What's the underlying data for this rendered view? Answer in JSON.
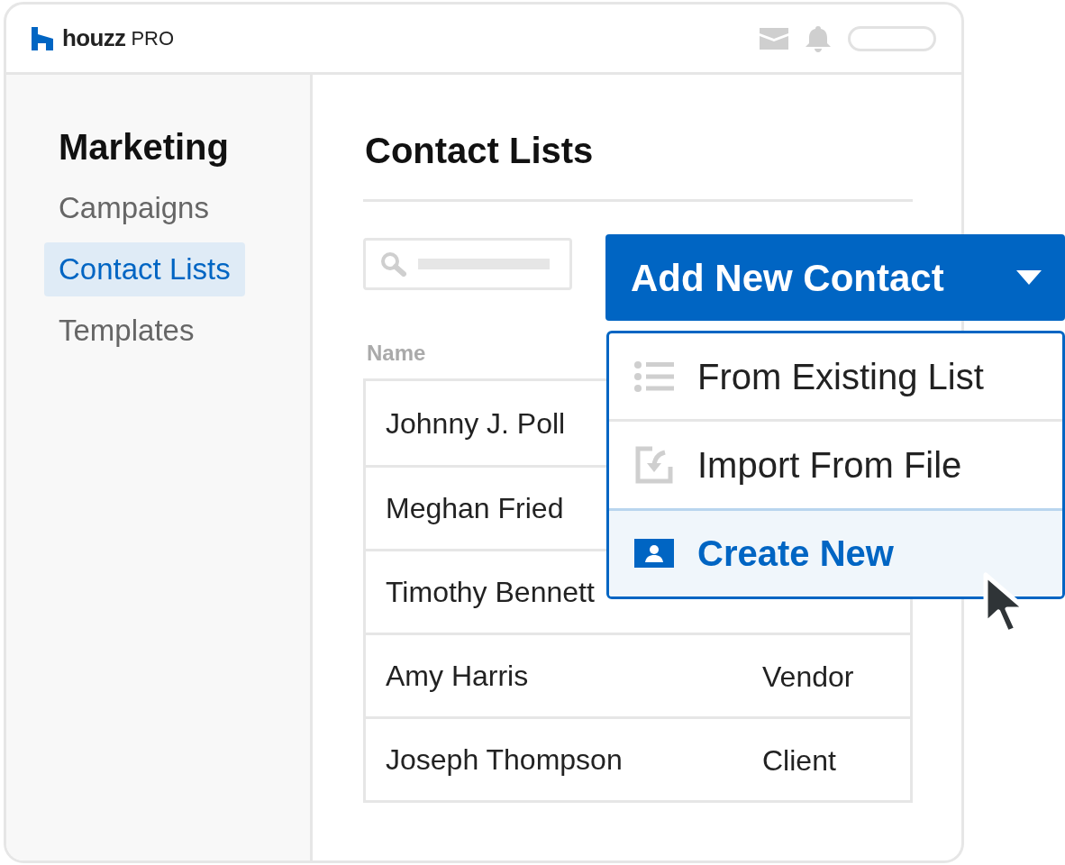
{
  "header": {
    "logo": "houzz",
    "logo_suffix": "PRO"
  },
  "sidebar": {
    "title": "Marketing",
    "items": [
      {
        "label": "Campaigns",
        "selected": false
      },
      {
        "label": "Contact Lists",
        "selected": true
      },
      {
        "label": "Templates",
        "selected": false
      }
    ]
  },
  "page_title": "Contact Lists",
  "add_button": {
    "label": "Add New Contact"
  },
  "dropdown": {
    "items": [
      {
        "kind": "list",
        "label": "From Existing List",
        "selected": false
      },
      {
        "kind": "import",
        "label": "Import From File",
        "selected": false
      },
      {
        "kind": "contact",
        "label": "Create New",
        "selected": true
      }
    ]
  },
  "table": {
    "columns": [
      "Name"
    ],
    "rows": [
      {
        "name": "Johnny J. Poll"
      },
      {
        "name": "Meghan Fried"
      },
      {
        "name": "Timothy Bennett"
      },
      {
        "name": "Amy Harris",
        "type": "Vendor"
      },
      {
        "name": "Joseph Thompson",
        "type": "Client"
      }
    ]
  }
}
